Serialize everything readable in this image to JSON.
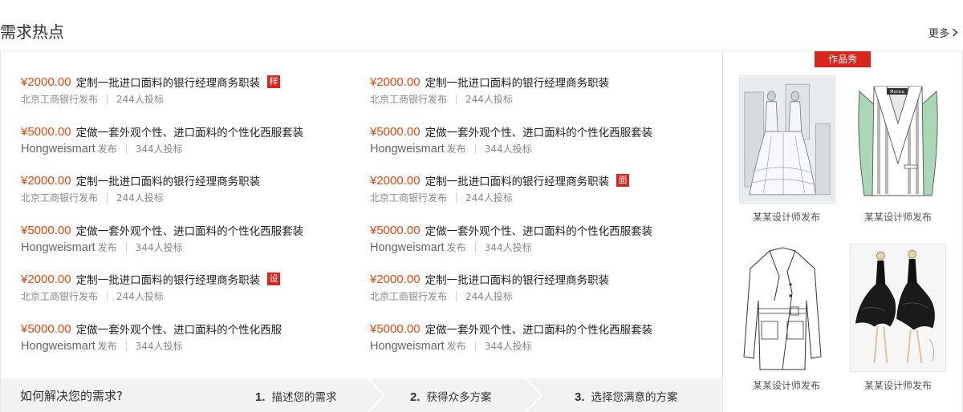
{
  "header": {
    "title": "需求热点",
    "more_label": "更多"
  },
  "demands": [
    {
      "price": "¥2000.00",
      "title": "定制一批进口面料的银行经理商务职装",
      "tag": "样",
      "publisher": "北京工商银行发布",
      "publisher_suffix": "",
      "bids": "244人投标"
    },
    {
      "price": "¥2000.00",
      "title": "定制一批进口面料的银行经理商务职装",
      "tag": "",
      "publisher": "北京工商银行发布",
      "publisher_suffix": "",
      "bids": "244人投标"
    },
    {
      "price": "¥5000.00",
      "title": "定做一套外观个性、进口面料的个性化西服套装",
      "tag": "",
      "publisher": "Hongweismart",
      "publisher_suffix": "发布",
      "bids": "344人投标"
    },
    {
      "price": "¥5000.00",
      "title": "定做一套外观个性、进口面料的个性化西服套装",
      "tag": "",
      "publisher": "Hongweismart",
      "publisher_suffix": "发布",
      "bids": "344人投标"
    },
    {
      "price": "¥2000.00",
      "title": "定制一批进口面料的银行经理商务职装",
      "tag": "",
      "publisher": "北京工商银行发布",
      "publisher_suffix": "",
      "bids": "244人投标"
    },
    {
      "price": "¥2000.00",
      "title": "定制一批进口面料的银行经理商务职装",
      "tag": "面",
      "publisher": "北京工商银行发布",
      "publisher_suffix": "",
      "bids": "244人投标"
    },
    {
      "price": "¥5000.00",
      "title": "定做一套外观个性、进口面料的个性化西服套装",
      "tag": "",
      "publisher": "Hongweismart",
      "publisher_suffix": "发布",
      "bids": "344人投标"
    },
    {
      "price": "¥5000.00",
      "title": "定做一套外观个性、进口面料的个性化西服套装",
      "tag": "",
      "publisher": "Hongweismart",
      "publisher_suffix": "发布",
      "bids": "344人投标"
    },
    {
      "price": "¥2000.00",
      "title": "定制一批进口面料的银行经理商务职装",
      "tag": "设",
      "publisher": "北京工商银行发布",
      "publisher_suffix": "",
      "bids": "244人投标"
    },
    {
      "price": "¥2000.00",
      "title": "定制一批进口面料的银行经理商务职装",
      "tag": "",
      "publisher": "北京工商银行发布",
      "publisher_suffix": "",
      "bids": "244人投标"
    },
    {
      "price": "¥5000.00",
      "title": "定做一套外观个性、进口面料的个性化西服",
      "tag": "",
      "publisher": "Hongweismart",
      "publisher_suffix": "发布",
      "bids": "344人投标"
    },
    {
      "price": "¥5000.00",
      "title": "定做一套外观个性、进口面料的个性化西服套装",
      "tag": "",
      "publisher": "Hongweismart",
      "publisher_suffix": "发布",
      "bids": "344人投标"
    }
  ],
  "howto": {
    "question": "如何解决您的需求?",
    "steps": [
      {
        "num": "1.",
        "label": "描述您的需求"
      },
      {
        "num": "2.",
        "label": "获得众多方案"
      },
      {
        "num": "3.",
        "label": "选择您满意的方案"
      }
    ]
  },
  "works": {
    "badge": "作品秀",
    "items": [
      {
        "caption": "某某设计师发布",
        "image": "dress-sketch-icon"
      },
      {
        "caption": "某某设计师发布",
        "image": "striped-blazer-icon"
      },
      {
        "caption": "某某设计师发布",
        "image": "trench-coat-sketch-icon"
      },
      {
        "caption": "某某设计师发布",
        "image": "black-gown-sketch-icon"
      }
    ]
  },
  "colors": {
    "price": "#e8470e",
    "tag": "#d8261c",
    "badge": "#d8261c",
    "howto_bg": "#f2f2f2"
  }
}
